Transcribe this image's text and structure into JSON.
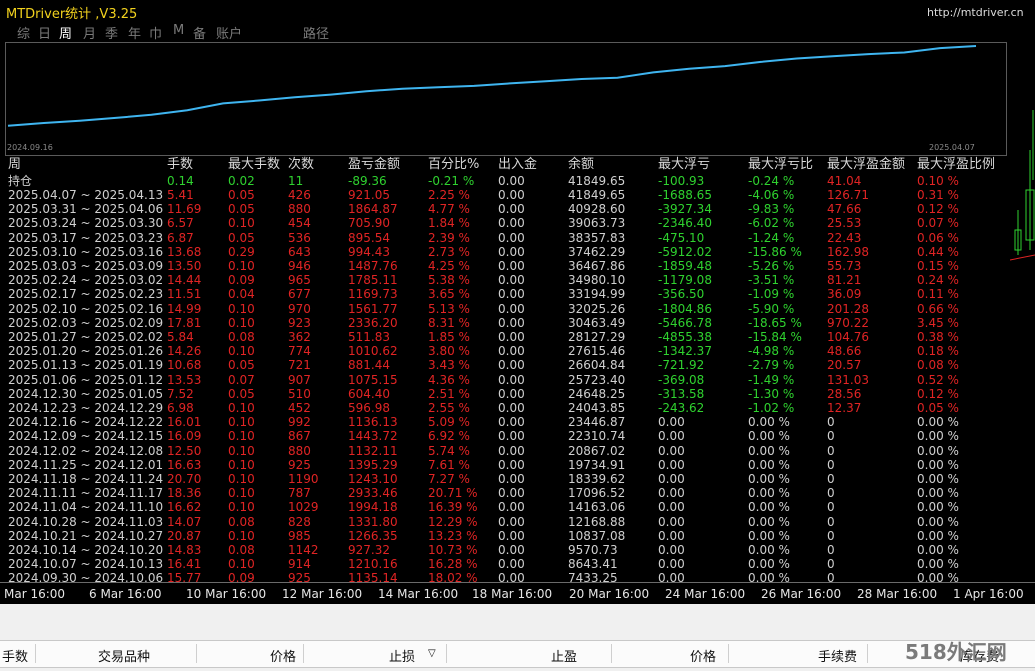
{
  "title": "MTDriver统计 ,V3.25",
  "url": "http://mtdriver.cn",
  "menu": [
    "综",
    "日",
    "周",
    "月",
    "季",
    "年",
    "巾",
    "M",
    "备",
    "账户",
    "路径"
  ],
  "menu_active": "周",
  "equity": {
    "start_date": "2024.09.16",
    "end_date": "2025.04.07",
    "values": [
      7433.25,
      8643.41,
      9570.73,
      10837.08,
      12168.88,
      14163.06,
      17096.52,
      18339.62,
      19734.91,
      20867.02,
      22310.74,
      23446.87,
      24043.85,
      24648.25,
      25723.4,
      26604.84,
      27615.46,
      28127.29,
      30463.49,
      32025.26,
      33194.99,
      34980.1,
      36467.86,
      37462.29,
      38357.83,
      39063.73,
      40928.6,
      41849.65
    ],
    "line_color": "#3fb5f0"
  },
  "headers": [
    "周",
    "手数",
    "最大手数",
    "次数",
    "盈亏金额",
    "百分比%",
    "出入金",
    "余额",
    "最大浮亏",
    "最大浮亏比",
    "最大浮盈金额",
    "最大浮盈比例"
  ],
  "holding": {
    "label": "持仓",
    "lots": "0.14",
    "max_lots": "0.02",
    "count": "11",
    "pnl": "-89.36",
    "pct": "-0.21 %",
    "io": "0.00",
    "bal": "41849.65",
    "maxdd": "-100.93",
    "ddpct": "-0.24 %",
    "maxfp": "41.04",
    "fppct": "0.10 %"
  },
  "rows": [
    [
      "2025.04.07 ~ 2025.04.13",
      "5.41",
      "0.05",
      "426",
      "921.05",
      "2.25 %",
      "0.00",
      "41849.65",
      "-1688.65",
      "-4.06 %",
      "126.71",
      "0.31 %"
    ],
    [
      "2025.03.31 ~ 2025.04.06",
      "11.69",
      "0.05",
      "880",
      "1864.87",
      "4.77 %",
      "0.00",
      "40928.60",
      "-3927.34",
      "-9.83 %",
      "47.66",
      "0.12 %"
    ],
    [
      "2025.03.24 ~ 2025.03.30",
      "6.57",
      "0.10",
      "454",
      "705.90",
      "1.84 %",
      "0.00",
      "39063.73",
      "-2346.40",
      "-6.02 %",
      "25.53",
      "0.07 %"
    ],
    [
      "2025.03.17 ~ 2025.03.23",
      "6.87",
      "0.05",
      "536",
      "895.54",
      "2.39 %",
      "0.00",
      "38357.83",
      "-475.10",
      "-1.24 %",
      "22.43",
      "0.06 %"
    ],
    [
      "2025.03.10 ~ 2025.03.16",
      "13.68",
      "0.29",
      "643",
      "994.43",
      "2.73 %",
      "0.00",
      "37462.29",
      "-5912.02",
      "-15.86 %",
      "162.98",
      "0.44 %"
    ],
    [
      "2025.03.03 ~ 2025.03.09",
      "13.50",
      "0.10",
      "946",
      "1487.76",
      "4.25 %",
      "0.00",
      "36467.86",
      "-1859.48",
      "-5.26 %",
      "55.73",
      "0.15 %"
    ],
    [
      "2025.02.24 ~ 2025.03.02",
      "14.44",
      "0.09",
      "965",
      "1785.11",
      "5.38 %",
      "0.00",
      "34980.10",
      "-1179.08",
      "-3.51 %",
      "81.21",
      "0.24 %"
    ],
    [
      "2025.02.17 ~ 2025.02.23",
      "11.51",
      "0.04",
      "677",
      "1169.73",
      "3.65 %",
      "0.00",
      "33194.99",
      "-356.50",
      "-1.09 %",
      "36.09",
      "0.11 %"
    ],
    [
      "2025.02.10 ~ 2025.02.16",
      "14.99",
      "0.10",
      "970",
      "1561.77",
      "5.13 %",
      "0.00",
      "32025.26",
      "-1804.86",
      "-5.90 %",
      "201.28",
      "0.66 %"
    ],
    [
      "2025.02.03 ~ 2025.02.09",
      "17.81",
      "0.10",
      "923",
      "2336.20",
      "8.31 %",
      "0.00",
      "30463.49",
      "-5466.78",
      "-18.65 %",
      "970.22",
      "3.45 %"
    ],
    [
      "2025.01.27 ~ 2025.02.02",
      "5.84",
      "0.08",
      "362",
      "511.83",
      "1.85 %",
      "0.00",
      "28127.29",
      "-4855.38",
      "-15.84 %",
      "104.76",
      "0.38 %"
    ],
    [
      "2025.01.20 ~ 2025.01.26",
      "14.26",
      "0.10",
      "774",
      "1010.62",
      "3.80 %",
      "0.00",
      "27615.46",
      "-1342.37",
      "-4.98 %",
      "48.66",
      "0.18 %"
    ],
    [
      "2025.01.13 ~ 2025.01.19",
      "10.68",
      "0.05",
      "721",
      "881.44",
      "3.43 %",
      "0.00",
      "26604.84",
      "-721.92",
      "-2.79 %",
      "20.57",
      "0.08 %"
    ],
    [
      "2025.01.06 ~ 2025.01.12",
      "13.53",
      "0.07",
      "907",
      "1075.15",
      "4.36 %",
      "0.00",
      "25723.40",
      "-369.08",
      "-1.49 %",
      "131.03",
      "0.52 %"
    ],
    [
      "2024.12.30 ~ 2025.01.05",
      "7.52",
      "0.05",
      "510",
      "604.40",
      "2.51 %",
      "0.00",
      "24648.25",
      "-313.58",
      "-1.30 %",
      "28.56",
      "0.12 %"
    ],
    [
      "2024.12.23 ~ 2024.12.29",
      "6.98",
      "0.10",
      "452",
      "596.98",
      "2.55 %",
      "0.00",
      "24043.85",
      "-243.62",
      "-1.02 %",
      "12.37",
      "0.05 %"
    ],
    [
      "2024.12.16 ~ 2024.12.22",
      "16.01",
      "0.10",
      "992",
      "1136.13",
      "5.09 %",
      "0.00",
      "23446.87",
      "0.00",
      "0.00 %",
      "0",
      "0.00 %"
    ],
    [
      "2024.12.09 ~ 2024.12.15",
      "16.09",
      "0.10",
      "867",
      "1443.72",
      "6.92 %",
      "0.00",
      "22310.74",
      "0.00",
      "0.00 %",
      "0",
      "0.00 %"
    ],
    [
      "2024.12.02 ~ 2024.12.08",
      "12.50",
      "0.10",
      "880",
      "1132.11",
      "5.74 %",
      "0.00",
      "20867.02",
      "0.00",
      "0.00 %",
      "0",
      "0.00 %"
    ],
    [
      "2024.11.25 ~ 2024.12.01",
      "16.63",
      "0.10",
      "925",
      "1395.29",
      "7.61 %",
      "0.00",
      "19734.91",
      "0.00",
      "0.00 %",
      "0",
      "0.00 %"
    ],
    [
      "2024.11.18 ~ 2024.11.24",
      "20.70",
      "0.10",
      "1190",
      "1243.10",
      "7.27 %",
      "0.00",
      "18339.62",
      "0.00",
      "0.00 %",
      "0",
      "0.00 %"
    ],
    [
      "2024.11.11 ~ 2024.11.17",
      "18.36",
      "0.10",
      "787",
      "2933.46",
      "20.71 %",
      "0.00",
      "17096.52",
      "0.00",
      "0.00 %",
      "0",
      "0.00 %"
    ],
    [
      "2024.11.04 ~ 2024.11.10",
      "16.62",
      "0.10",
      "1029",
      "1994.18",
      "16.39 %",
      "0.00",
      "14163.06",
      "0.00",
      "0.00 %",
      "0",
      "0.00 %"
    ],
    [
      "2024.10.28 ~ 2024.11.03",
      "14.07",
      "0.08",
      "828",
      "1331.80",
      "12.29 %",
      "0.00",
      "12168.88",
      "0.00",
      "0.00 %",
      "0",
      "0.00 %"
    ],
    [
      "2024.10.21 ~ 2024.10.27",
      "20.87",
      "0.10",
      "985",
      "1266.35",
      "13.23 %",
      "0.00",
      "10837.08",
      "0.00",
      "0.00 %",
      "0",
      "0.00 %"
    ],
    [
      "2024.10.14 ~ 2024.10.20",
      "14.83",
      "0.08",
      "1142",
      "927.32",
      "10.73 %",
      "0.00",
      "9570.73",
      "0.00",
      "0.00 %",
      "0",
      "0.00 %"
    ],
    [
      "2024.10.07 ~ 2024.10.13",
      "16.41",
      "0.10",
      "914",
      "1210.16",
      "16.28 %",
      "0.00",
      "8643.41",
      "0.00",
      "0.00 %",
      "0",
      "0.00 %"
    ],
    [
      "2024.09.30 ~ 2024.10.06",
      "15.77",
      "0.09",
      "925",
      "1135.14",
      "18.02 %",
      "0.00",
      "7433.25",
      "0.00",
      "0.00 %",
      "0",
      "0.00 %"
    ]
  ],
  "xaxis": [
    "Mar 16:00",
    "6 Mar 16:00",
    "10 Mar 16:00",
    "12 Mar 16:00",
    "14 Mar 16:00",
    "18 Mar 16:00",
    "20 Mar 16:00",
    "24 Mar 16:00",
    "26 Mar 16:00",
    "28 Mar 16:00",
    "1 Apr 16:00"
  ],
  "bottom_headers": [
    "手数",
    "交易品种",
    "价格",
    "止损",
    "止盈",
    "价格",
    "手续费",
    "库存费"
  ],
  "watermark": "518外汇网",
  "colors": {
    "positive": "#e02424",
    "negative": "#2fd22f",
    "neutral": "#d0d0d0",
    "title": "#f2d21e"
  }
}
